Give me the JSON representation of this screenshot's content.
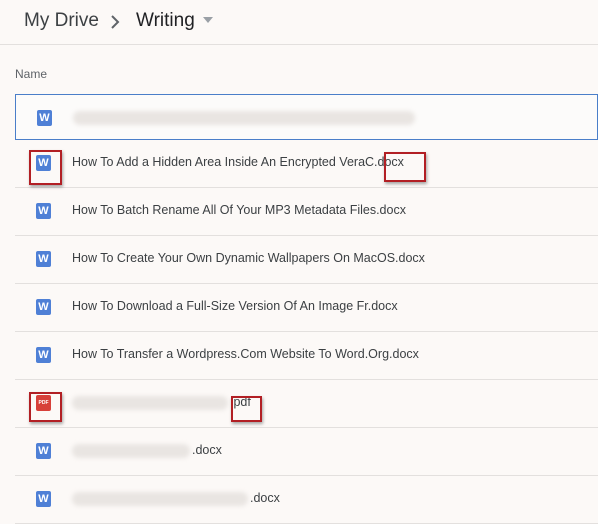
{
  "breadcrumb": {
    "root": "My Drive",
    "current": "Writing"
  },
  "list_header": {
    "name_column": "Name"
  },
  "files": [
    {
      "name": "",
      "type": "docx",
      "icon": "word-doc-icon",
      "icon_letter": "W",
      "blurred": true
    },
    {
      "name": "How To Add a Hidden Area Inside An Encrypted VeraC.docx",
      "type": "docx",
      "icon": "word-doc-icon",
      "icon_letter": "W"
    },
    {
      "name": "How To Batch Rename All Of Your MP3 Metadata Files.docx",
      "type": "docx",
      "icon": "word-doc-icon",
      "icon_letter": "W"
    },
    {
      "name": "How To Create Your Own Dynamic Wallpapers On MacOS.docx",
      "type": "docx",
      "icon": "word-doc-icon",
      "icon_letter": "W"
    },
    {
      "name": "How To Download a Full-Size Version Of An Image Fr.docx",
      "type": "docx",
      "icon": "word-doc-icon",
      "icon_letter": "W"
    },
    {
      "name": "How To Transfer a Wordpress.Com Website To Word.Org.docx",
      "type": "docx",
      "icon": "word-doc-icon",
      "icon_letter": "W"
    },
    {
      "name": ".pdf",
      "type": "pdf",
      "icon": "pdf-icon",
      "icon_letter": "PDF",
      "blurred": true
    },
    {
      "name": ".docx",
      "type": "docx",
      "icon": "word-doc-icon",
      "icon_letter": "W",
      "blurred": true
    },
    {
      "name": ".docx",
      "type": "docx",
      "icon": "word-doc-icon",
      "icon_letter": "W",
      "blurred": true
    }
  ],
  "colors": {
    "word_icon": "#4f80d6",
    "pdf_icon": "#d7403a",
    "selection_border": "#4a7ec9",
    "highlight_box": "#b21f24"
  }
}
